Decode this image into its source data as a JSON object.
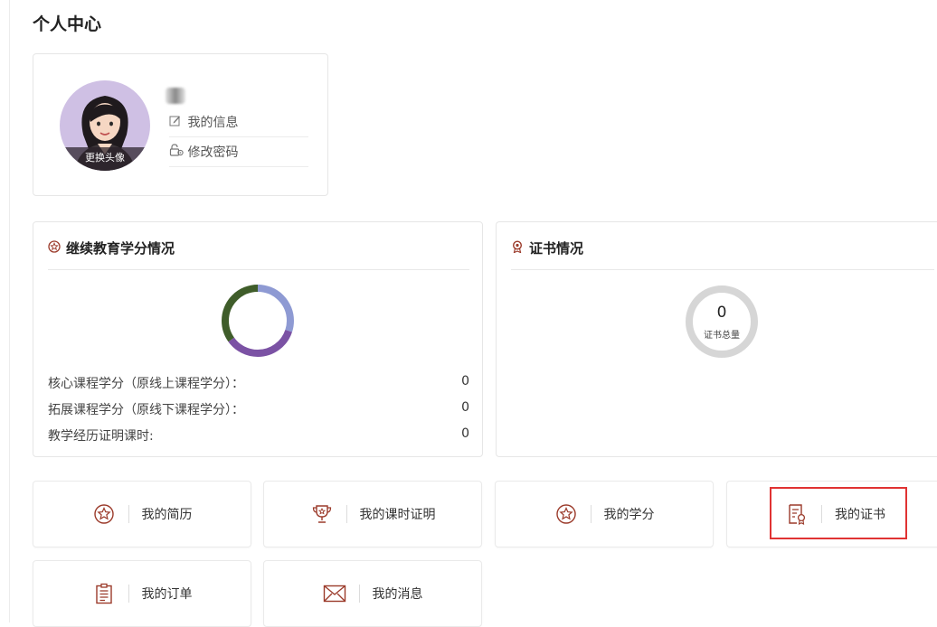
{
  "page": {
    "title": "个人中心"
  },
  "profile": {
    "avatar_button": "更换头像",
    "links": {
      "my_info": "我的信息",
      "change_password": "修改密码"
    }
  },
  "credits": {
    "title": "继续教育学分情况",
    "rows": [
      {
        "label": "核心课程学分（原线上课程学分）：",
        "value": "0"
      },
      {
        "label": "拓展课程学分（原线下课程学分）：",
        "value": "0"
      },
      {
        "label": "教学经历证明课时:",
        "value": "0"
      }
    ]
  },
  "certificates": {
    "title": "证书情况",
    "count": "0",
    "count_label": "证书总量"
  },
  "tiles": [
    {
      "label": "我的简历",
      "icon": "star-badge-icon"
    },
    {
      "label": "我的课时证明",
      "icon": "trophy-icon"
    },
    {
      "label": "我的学分",
      "icon": "star-badge-icon"
    },
    {
      "label": "我的证书",
      "icon": "certificate-icon"
    },
    {
      "label": "我的订单",
      "icon": "clipboard-icon"
    },
    {
      "label": "我的消息",
      "icon": "envelope-icon"
    }
  ],
  "colors": {
    "accent": "#9b3a2a",
    "donut": [
      "#8e9ad3",
      "#7b52a4",
      "#3f5d2a"
    ],
    "highlight": "#e03333"
  }
}
